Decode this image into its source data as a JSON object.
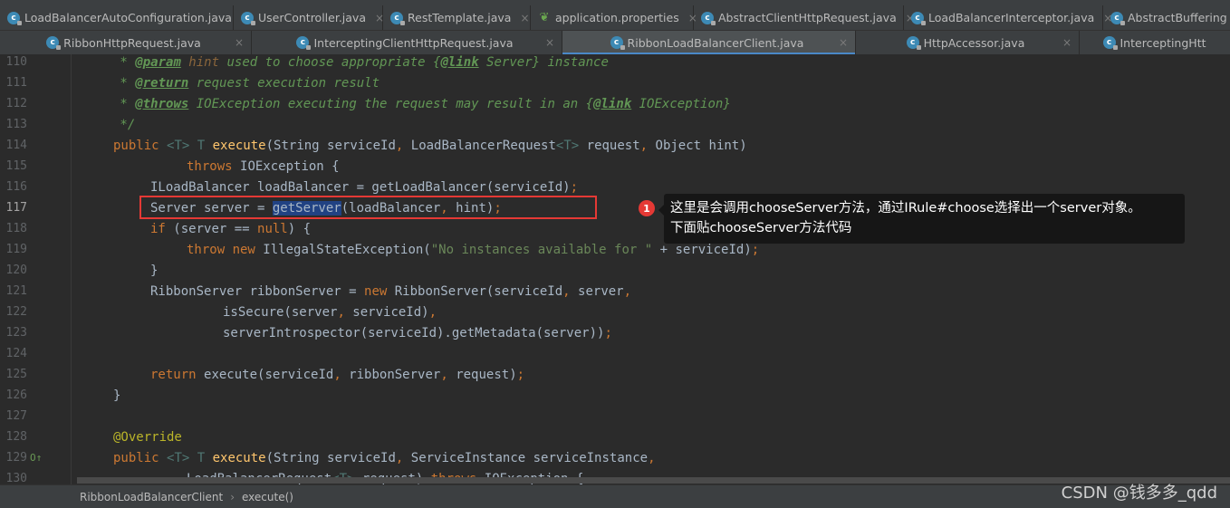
{
  "tabs_row1": [
    {
      "label": "LoadBalancerAutoConfiguration.java",
      "icon": "class-icon"
    },
    {
      "label": "UserController.java",
      "icon": "class-icon"
    },
    {
      "label": "RestTemplate.java",
      "icon": "class-icon"
    },
    {
      "label": "application.properties",
      "icon": "spring-leaf-icon"
    },
    {
      "label": "AbstractClientHttpRequest.java",
      "icon": "class-icon"
    },
    {
      "label": "LoadBalancerInterceptor.java",
      "icon": "class-icon"
    },
    {
      "label": "AbstractBuffering",
      "icon": "class-icon"
    }
  ],
  "tabs_row2": [
    {
      "label": "RibbonHttpRequest.java",
      "icon": "class-icon"
    },
    {
      "label": "InterceptingClientHttpRequest.java",
      "icon": "class-icon"
    },
    {
      "label": "RibbonLoadBalancerClient.java",
      "icon": "class-icon",
      "active": true
    },
    {
      "label": "HttpAccessor.java",
      "icon": "class-icon"
    },
    {
      "label": "InterceptingHtt",
      "icon": "class-icon"
    }
  ],
  "close_glyph": "×",
  "lines": [
    {
      "n": "110"
    },
    {
      "n": "111"
    },
    {
      "n": "112"
    },
    {
      "n": "113"
    },
    {
      "n": "114"
    },
    {
      "n": "115"
    },
    {
      "n": "116"
    },
    {
      "n": "117"
    },
    {
      "n": "118"
    },
    {
      "n": "119"
    },
    {
      "n": "120"
    },
    {
      "n": "121"
    },
    {
      "n": "122"
    },
    {
      "n": "123"
    },
    {
      "n": "124"
    },
    {
      "n": "125"
    },
    {
      "n": "126"
    },
    {
      "n": "127"
    },
    {
      "n": "128"
    },
    {
      "n": "129"
    },
    {
      "n": "130"
    }
  ],
  "code": {
    "l110": {
      "star": " * ",
      "tag": "@param",
      "pn": " hint",
      "rest": " used to choose appropriate {",
      "link": "@link",
      "after": " Server} instance"
    },
    "l111": {
      "star": " * ",
      "tag": "@return",
      "rest": " request execution result"
    },
    "l112": {
      "star": " * ",
      "tag": "@throws",
      "rest": " IOException executing the request may result in an {",
      "link": "@link",
      "after": " IOException}"
    },
    "l113": {
      "text": " */"
    },
    "l114": {
      "kw": "public ",
      "tp1": "<T> ",
      "tp2": "T ",
      "fn": "execute",
      "rest": "(String serviceId",
      "c1": ", ",
      "rest2": "LoadBalancerRequest",
      "tp3": "<T>",
      "rest3": " request",
      "c2": ", ",
      "rest4": "Object hint)"
    },
    "l115": {
      "kw": "throws ",
      "rest": "IOException {"
    },
    "l116": {
      "text": "ILoadBalancer loadBalancer = getLoadBalancer(serviceId)",
      "semi": ";"
    },
    "l117": {
      "pre": "Server server = ",
      "sel": "getServer",
      "rest": "(loadBalancer",
      "c": ", ",
      "rest2": "hint)",
      "semi": ";"
    },
    "l118": {
      "kw": "if ",
      "rest": "(server == ",
      "kw2": "null",
      "rest2": ") {"
    },
    "l119": {
      "kw": "throw new ",
      "rest": "IllegalStateException(",
      "str": "\"No instances available for \"",
      "rest2": " + serviceId)",
      "semi": ";"
    },
    "l120": {
      "text": "}"
    },
    "l121": {
      "pre": "RibbonServer ribbonServer = ",
      "kw": "new ",
      "rest": "RibbonServer(serviceId",
      "c": ", ",
      "rest2": "server",
      "c2": ","
    },
    "l122": {
      "rest": "isSecure(server",
      "c": ", ",
      "rest2": "serviceId)",
      "c2": ","
    },
    "l123": {
      "text": "serverIntrospector(serviceId).getMetadata(server))",
      "semi": ";"
    },
    "l125": {
      "kw": "return ",
      "rest": "execute(serviceId",
      "c": ", ",
      "rest2": "ribbonServer",
      "c2": ", ",
      "rest3": "request)",
      "semi": ";"
    },
    "l126": {
      "text": "}"
    },
    "l128": {
      "an": "@Override"
    },
    "l129": {
      "kw": "public ",
      "tp1": "<T> ",
      "tp2": "T ",
      "fn": "execute",
      "rest": "(String serviceId",
      "c": ", ",
      "rest2": "ServiceInstance serviceInstance",
      "c2": ","
    },
    "l130": {
      "rest": "LoadBalancerRequest",
      "tp": "<T>",
      "rest2": " request) ",
      "kw": "throws ",
      "rest3": "IOException {"
    }
  },
  "gutter_129_icon": "O↑",
  "annotation": {
    "badge": "1",
    "text_line1": "这里是会调用chooseServer方法，通过IRule#choose选择出一个server对象。",
    "text_line2": "下面贴chooseServer方法代码"
  },
  "breadcrumbs": [
    "RibbonLoadBalancerClient",
    "execute()"
  ],
  "breadcrumb_sep": "›",
  "watermark": "CSDN @钱多多_qdd"
}
